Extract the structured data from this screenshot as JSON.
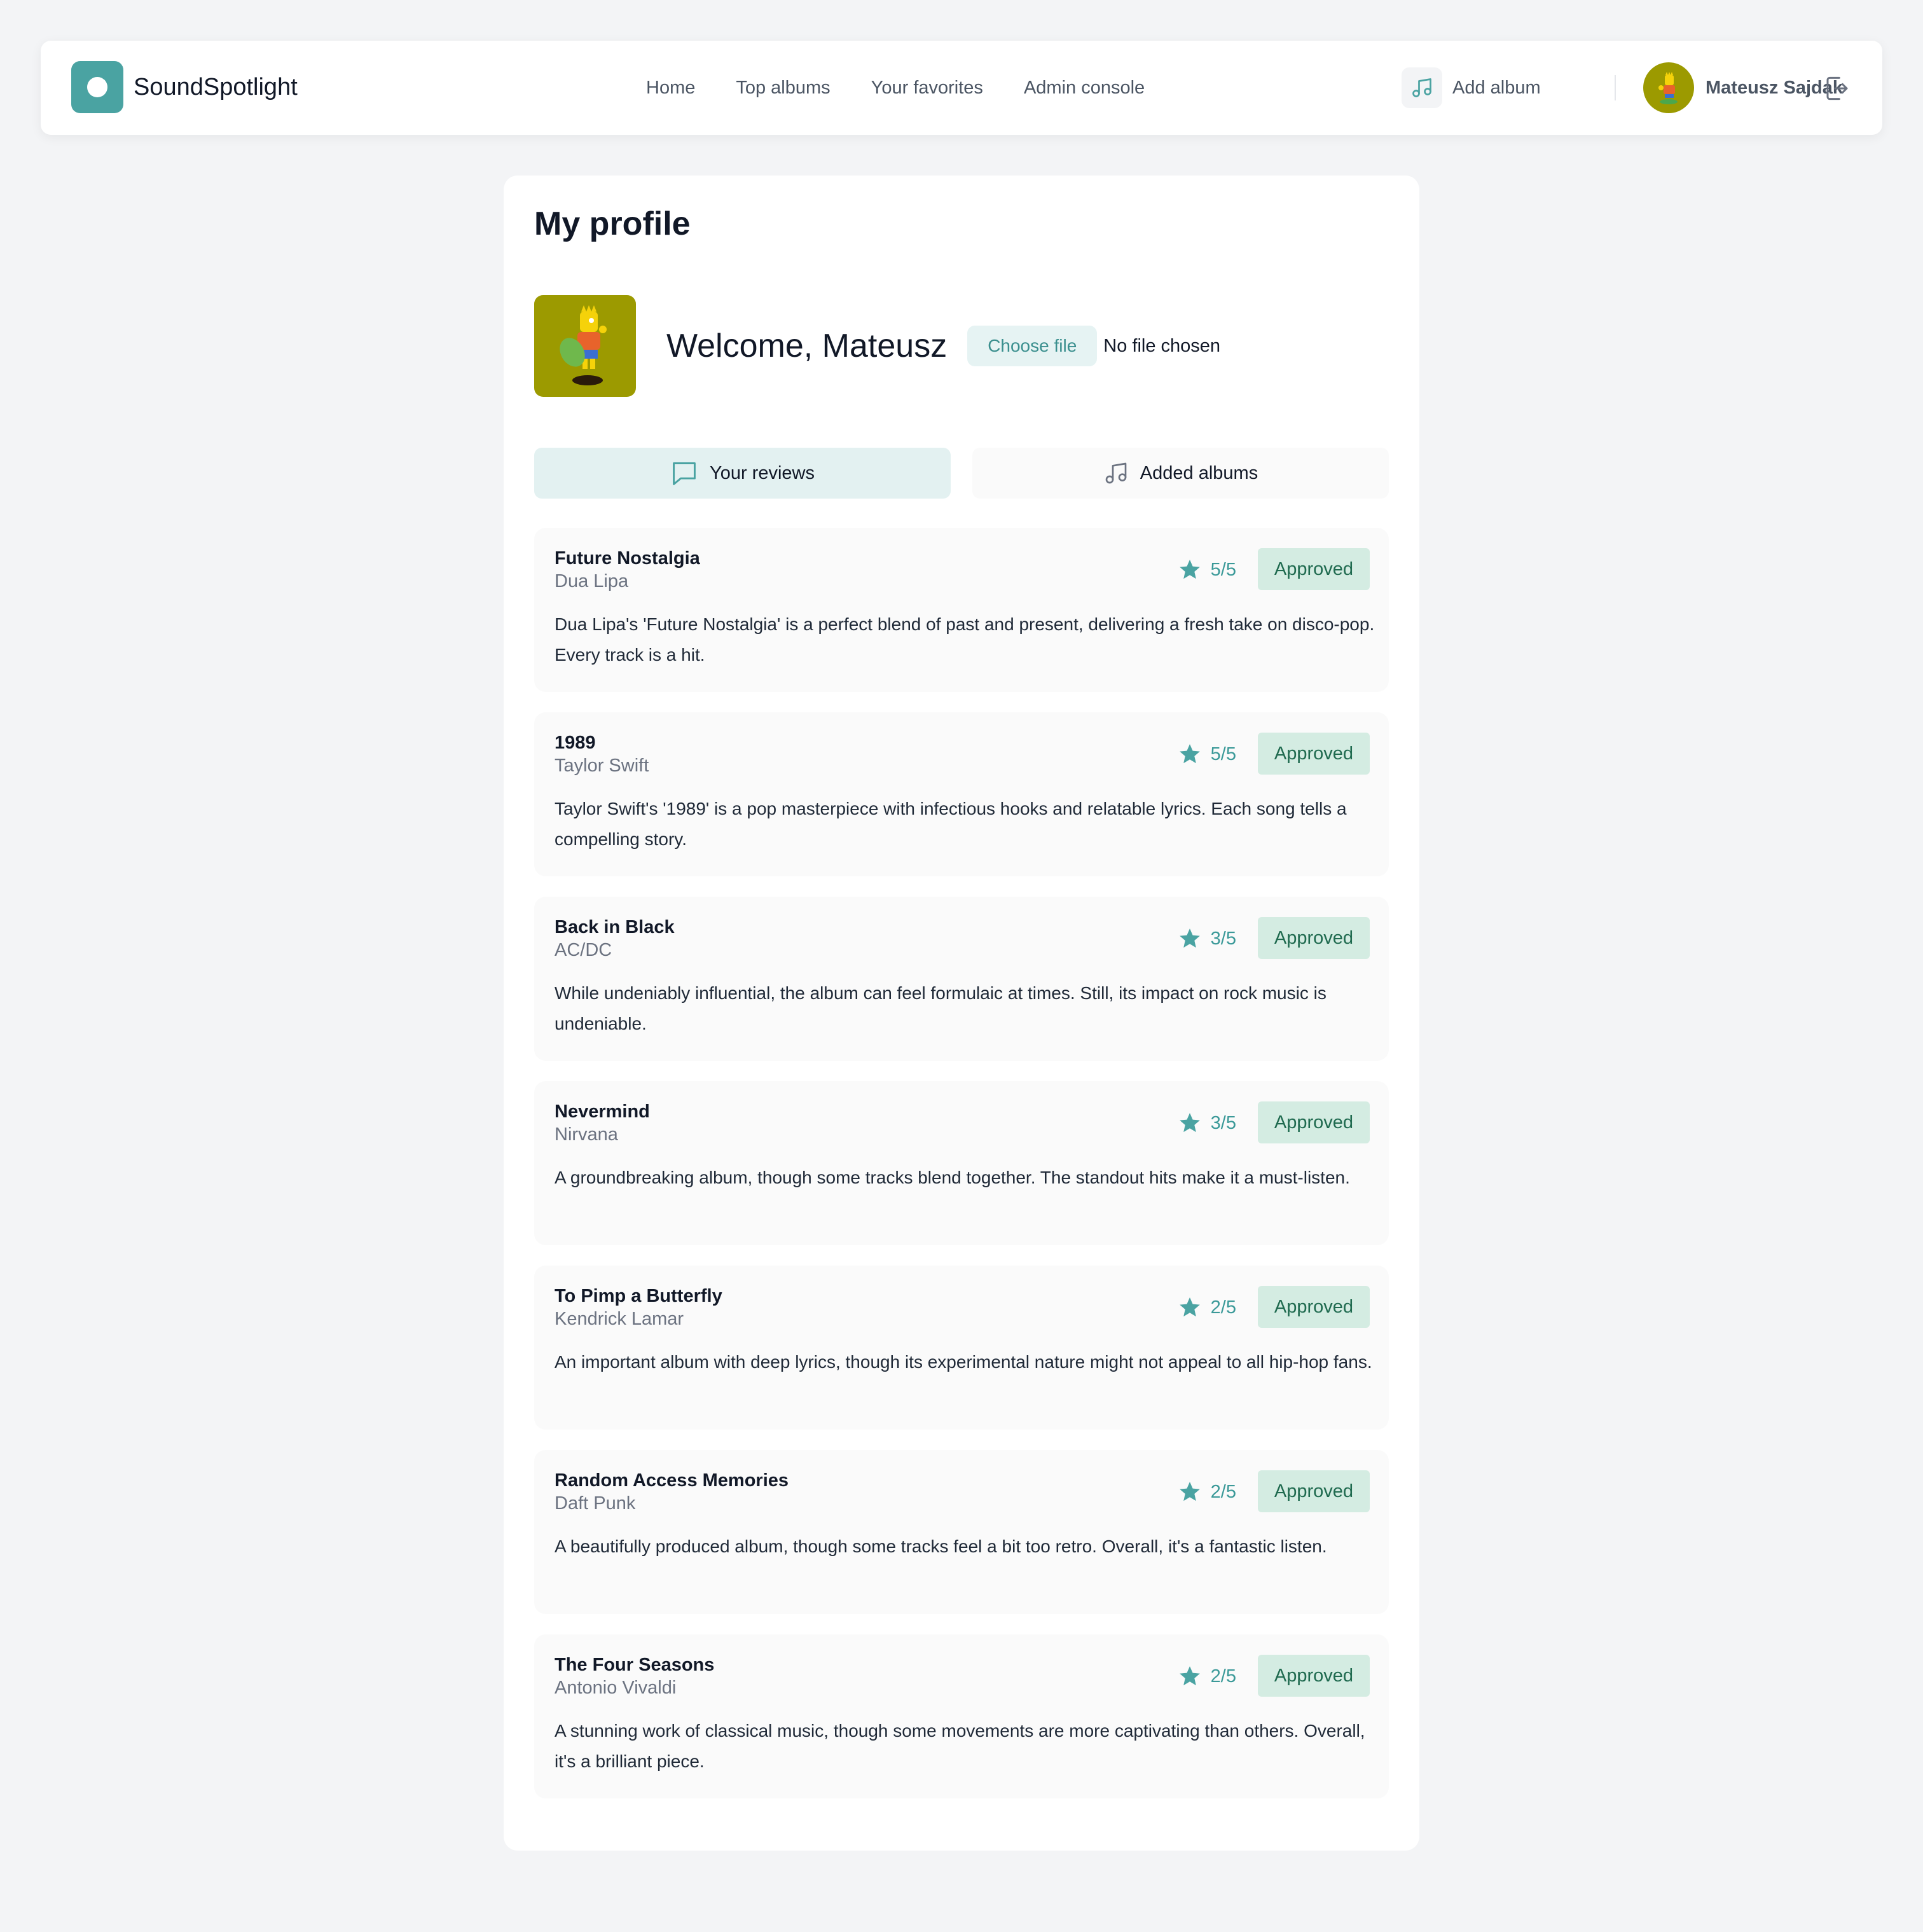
{
  "app": {
    "name": "SoundSpotlight"
  },
  "nav": {
    "links": [
      "Home",
      "Top albums",
      "Your favorites",
      "Admin console"
    ],
    "add_album_label": "Add album",
    "user_name": "Mateusz Sajdak"
  },
  "profile": {
    "title": "My profile",
    "welcome": "Welcome, Mateusz",
    "choose_file_label": "Choose file",
    "file_status": "No file chosen"
  },
  "tabs": [
    {
      "label": "Your reviews",
      "icon": "chat-bubble-icon",
      "active": true
    },
    {
      "label": "Added albums",
      "icon": "music-note-icon",
      "active": false
    }
  ],
  "reviews": [
    {
      "album": "Future Nostalgia",
      "artist": "Dua Lipa",
      "rating": "5/5",
      "status": "Approved",
      "text": "Dua Lipa's 'Future Nostalgia' is a perfect blend of past and present, delivering a fresh take on disco-pop. Every track is a hit."
    },
    {
      "album": "1989",
      "artist": "Taylor Swift",
      "rating": "5/5",
      "status": "Approved",
      "text": "Taylor Swift's '1989' is a pop masterpiece with infectious hooks and relatable lyrics. Each song tells a compelling story."
    },
    {
      "album": "Back in Black",
      "artist": "AC/DC",
      "rating": "3/5",
      "status": "Approved",
      "text": "While undeniably influential, the album can feel formulaic at times. Still, its impact on rock music is undeniable."
    },
    {
      "album": "Nevermind",
      "artist": "Nirvana",
      "rating": "3/5",
      "status": "Approved",
      "text": "A groundbreaking album, though some tracks blend together. The standout hits make it a must-listen."
    },
    {
      "album": "To Pimp a Butterfly",
      "artist": "Kendrick Lamar",
      "rating": "2/5",
      "status": "Approved",
      "text": "An important album with deep lyrics, though its experimental nature might not appeal to all hip-hop fans."
    },
    {
      "album": "Random Access Memories",
      "artist": "Daft Punk",
      "rating": "2/5",
      "status": "Approved",
      "text": "A beautifully produced album, though some tracks feel a bit too retro. Overall, it's a fantastic listen."
    },
    {
      "album": "The Four Seasons",
      "artist": "Antonio Vivaldi",
      "rating": "2/5",
      "status": "Approved",
      "text": "A stunning work of classical music, though some movements are more captivating than others. Overall, it's a brilliant piece."
    }
  ],
  "colors": {
    "accent": "#4aa3a2",
    "page_bg": "#f3f4f6",
    "badge_bg": "#d4ece2",
    "badge_text": "#1f6a4f",
    "avatar_bg": "#9c9a00"
  }
}
